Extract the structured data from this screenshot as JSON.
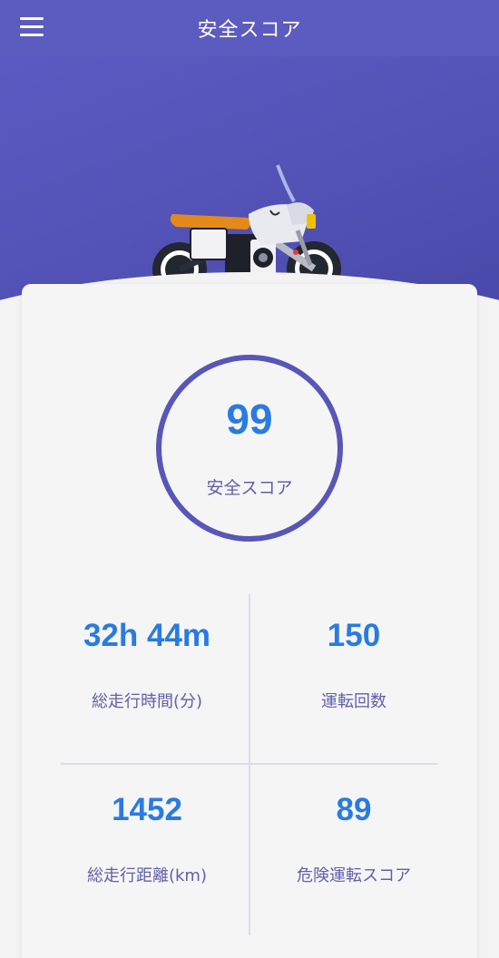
{
  "navbar": {
    "title": "安全スコア",
    "menu_icon": "hamburger-menu-icon"
  },
  "hero": {
    "illustration": "motorcycle-illustration"
  },
  "score": {
    "value": "99",
    "label": "安全スコア",
    "ring_color": "#5757b8"
  },
  "stats": [
    {
      "value": "32h 44m",
      "label": "総走行時間(分)"
    },
    {
      "value": "150",
      "label": "運転回数"
    },
    {
      "value": "1452",
      "label": "総走行距離(km)"
    },
    {
      "value": "89",
      "label": "危険運転スコア"
    }
  ],
  "colors": {
    "primary": "#5c5cc0",
    "value_blue": "#2a7be0",
    "label_purple": "#6060a8"
  }
}
